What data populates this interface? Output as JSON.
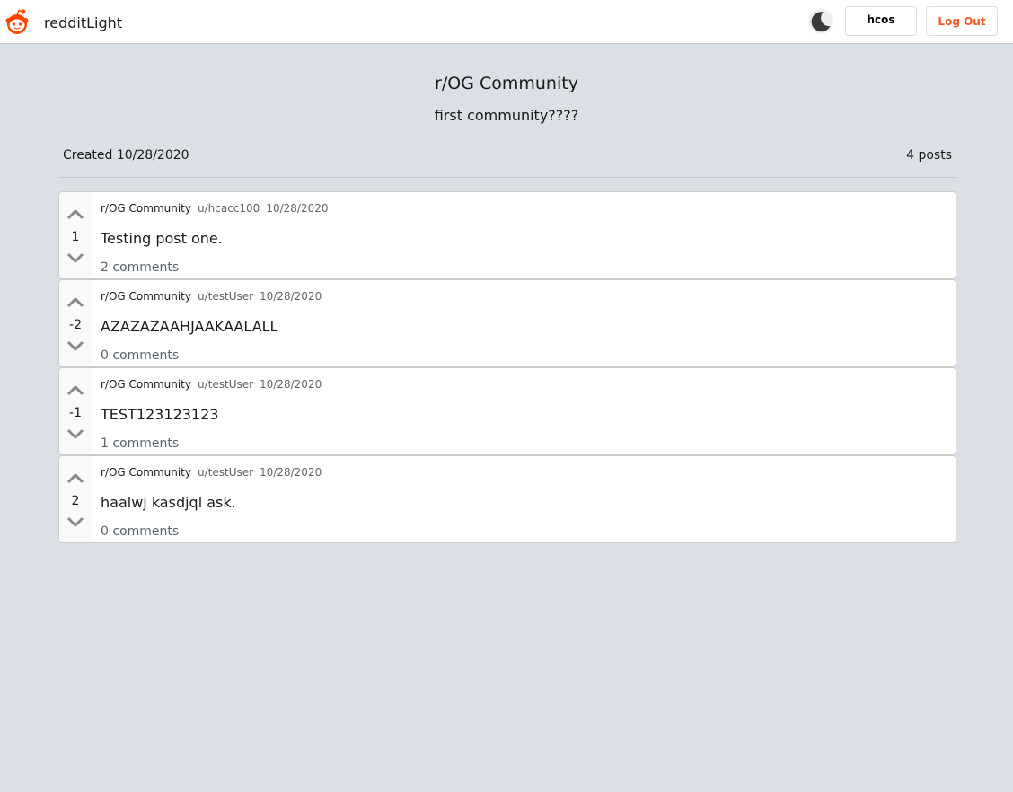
{
  "navbar": {
    "brand": "redditLight",
    "username": "hcos",
    "logout_label": "Log Out"
  },
  "community": {
    "title": "r/OG Community",
    "description": "first community????",
    "created": "Created 10/28/2020",
    "post_count": "4 posts"
  },
  "colors": {
    "accent": "#ff4500",
    "background": "#dae0e6",
    "logout_text": "#f05a28"
  },
  "icons": {
    "logo": "reddit-alien-icon",
    "theme_toggle": "moon-icon",
    "upvote": "chevron-up-icon",
    "downvote": "chevron-down-icon"
  },
  "posts": [
    {
      "community": "r/OG Community",
      "user": "u/hcacc100",
      "date": "10/28/2020",
      "score": "1",
      "title": "Testing post one.",
      "comments": "2 comments"
    },
    {
      "community": "r/OG Community",
      "user": "u/testUser",
      "date": "10/28/2020",
      "score": "-2",
      "title": "AZAZAZAAHJAAKAALALL",
      "comments": "0 comments"
    },
    {
      "community": "r/OG Community",
      "user": "u/testUser",
      "date": "10/28/2020",
      "score": "-1",
      "title": "TEST123123123",
      "comments": "1 comments"
    },
    {
      "community": "r/OG Community",
      "user": "u/testUser",
      "date": "10/28/2020",
      "score": "2",
      "title": "haalwj kasdjql ask.",
      "comments": "0 comments"
    }
  ]
}
